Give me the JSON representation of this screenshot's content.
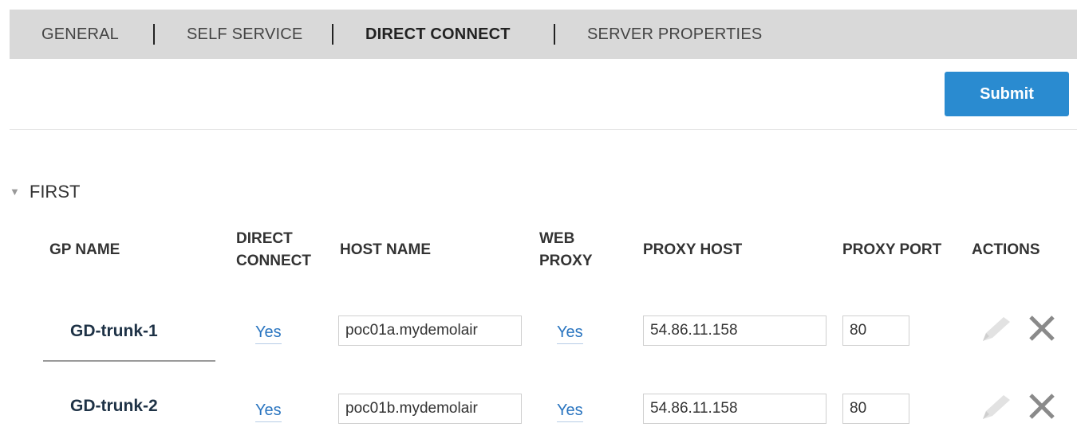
{
  "tabs": [
    {
      "label": "GENERAL",
      "active": false
    },
    {
      "label": "SELF SERVICE",
      "active": false
    },
    {
      "label": "DIRECT CONNECT",
      "active": true
    },
    {
      "label": "SERVER PROPERTIES",
      "active": false
    }
  ],
  "submit_label": "Submit",
  "section": {
    "title": "FIRST",
    "expanded": true
  },
  "columns": {
    "gp_name": "GP NAME",
    "direct_connect_l1": "DIRECT",
    "direct_connect_l2": "CONNECT",
    "host_name": "HOST NAME",
    "web_proxy_l1": "WEB",
    "web_proxy_l2": "PROXY",
    "proxy_host": "PROXY HOST",
    "proxy_port": "PROXY PORT",
    "actions": "ACTIONS"
  },
  "rows": [
    {
      "gp_name": "GD-trunk-1",
      "direct_connect": "Yes",
      "host_name": "poc01a.mydemolair",
      "web_proxy": "Yes",
      "proxy_host": "54.86.11.158",
      "proxy_port": "80"
    },
    {
      "gp_name": "GD-trunk-2",
      "direct_connect": "Yes",
      "host_name": "poc01b.mydemolair",
      "web_proxy": "Yes",
      "proxy_host": "54.86.11.158",
      "proxy_port": "80"
    }
  ],
  "icons": {
    "edit": "pencil-icon",
    "delete": "close-icon",
    "expand": "triangle-down-icon"
  },
  "colors": {
    "accent": "#2a8bd0",
    "link": "#2a75c0",
    "tabbar": "#d9d9d9"
  }
}
